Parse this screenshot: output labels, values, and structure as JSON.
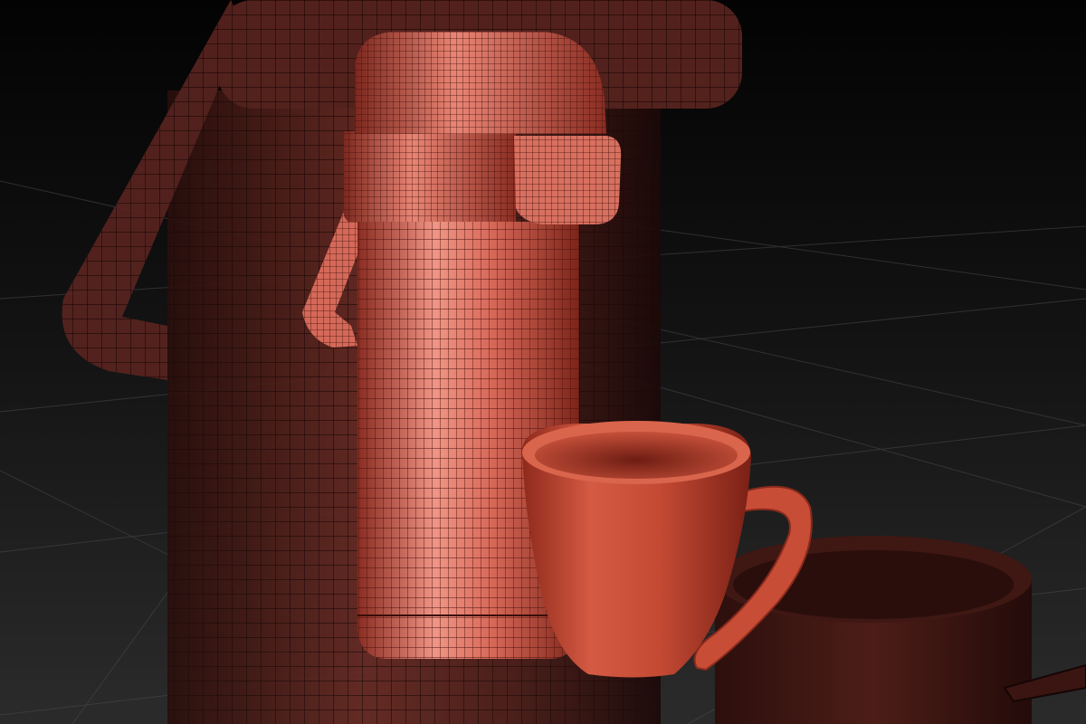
{
  "scene": {
    "background_top": "#050505",
    "background_bottom": "#2a2a2a",
    "grid_color": "#5a5a5a",
    "wire_color": "#3a0f0b"
  },
  "objects": [
    {
      "name": "large-thermos-background",
      "color": "#6e2c24"
    },
    {
      "name": "thermos-flask",
      "color": "#d96a5a"
    },
    {
      "name": "coffee-mug",
      "color": "#c2452f"
    },
    {
      "name": "cooking-pot-background",
      "color": "#4a1c17"
    }
  ]
}
